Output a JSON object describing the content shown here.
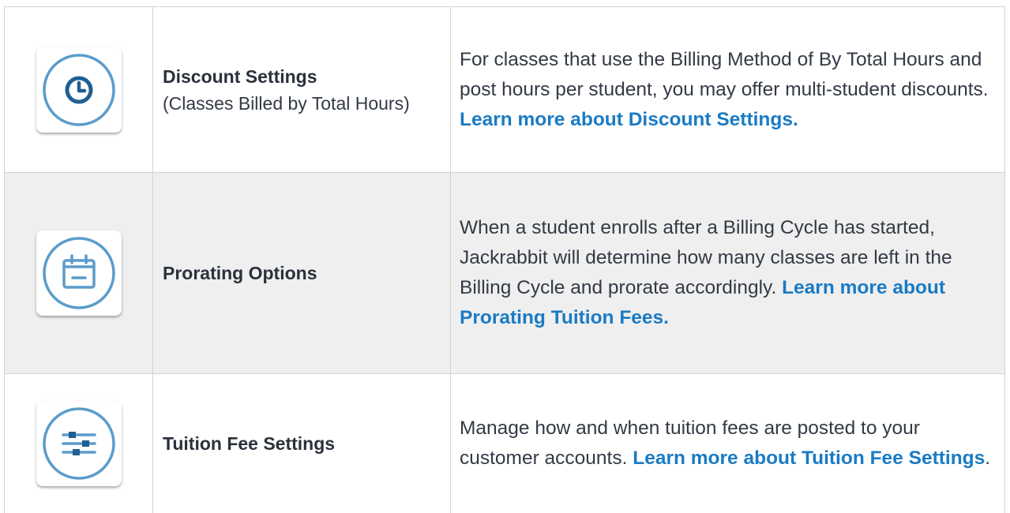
{
  "rows": [
    {
      "icon": "clock-icon",
      "title": "Discount Settings",
      "subtitle": "(Classes Billed by Total Hours)",
      "description": "For classes that use the Billing Method of By Total Hours and post hours per student, you may offer multi-student discounts. ",
      "link": "Learn more about Discount Settings.",
      "trail": ""
    },
    {
      "icon": "calendar-icon",
      "title": "Prorating Options",
      "subtitle": "",
      "description": "When a student enrolls after a Billing Cycle has started, Jackrabbit will determine how many classes are left in the Billing Cycle and prorate accordingly. ",
      "link": "Learn more about Prorating Tuition Fees.",
      "trail": ""
    },
    {
      "icon": "sliders-icon",
      "title": "Tuition Fee Settings",
      "subtitle": "",
      "description": "Manage how and when tuition fees are posted to your customer accounts. ",
      "link": "Learn more about Tuition Fee Settings",
      "trail": "."
    }
  ],
  "colors": {
    "icon_stroke": "#5b9ccb",
    "link": "#1a7bc4",
    "shaded_row": "#efefef",
    "border": "#d3d3d3"
  }
}
